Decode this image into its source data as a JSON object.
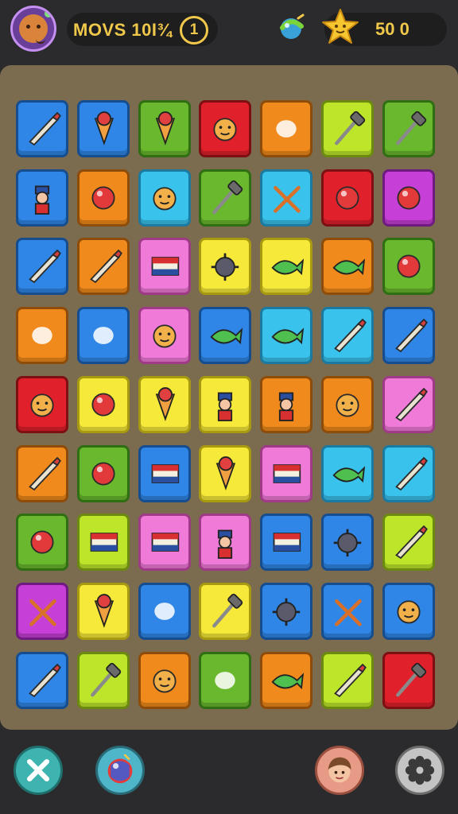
{
  "header": {
    "moves_label": "MOVS 10I¾",
    "moves_count": "1",
    "score": "50 0"
  },
  "colors": {
    "blue": "#2f86e6",
    "sky": "#39c3ec",
    "green": "#6ab82d",
    "red": "#e0202a",
    "orange": "#f08a1c",
    "lime": "#bde62a",
    "pink": "#f07ad8",
    "purple": "#c63fd6",
    "yellow": "#f6e93a",
    "board": "#7b6b4f"
  },
  "board": {
    "rows": 9,
    "cols": 7,
    "tiles": [
      [
        {
          "color": "blue",
          "icon": "crayon-icon"
        },
        {
          "color": "blue",
          "icon": "popsicle-icon"
        },
        {
          "color": "green",
          "icon": "chili-icon"
        },
        {
          "color": "red",
          "icon": "pig-face-icon"
        },
        {
          "color": "orange",
          "icon": "genie-lamp-icon"
        },
        {
          "color": "lime",
          "icon": "wrench-icon"
        },
        {
          "color": "green",
          "icon": "hammer-icon"
        }
      ],
      [
        {
          "color": "blue",
          "icon": "nutcracker-icon"
        },
        {
          "color": "orange",
          "icon": "spiky-ball-icon"
        },
        {
          "color": "sky",
          "icon": "gear-face-icon"
        },
        {
          "color": "green",
          "icon": "mallet-icon"
        },
        {
          "color": "sky",
          "icon": "stick-icon"
        },
        {
          "color": "red",
          "icon": "crystal-ball-icon"
        },
        {
          "color": "purple",
          "icon": "spiky-ball-icon"
        }
      ],
      [
        {
          "color": "blue",
          "icon": "green-crayon-icon"
        },
        {
          "color": "orange",
          "icon": "feather-icon"
        },
        {
          "color": "pink",
          "icon": "map-icon"
        },
        {
          "color": "yellow",
          "icon": "ship-wheel-icon"
        },
        {
          "color": "yellow",
          "icon": "bird-icon"
        },
        {
          "color": "orange",
          "icon": "slime-icon"
        },
        {
          "color": "green",
          "icon": "beach-ball-icon"
        }
      ],
      [
        {
          "color": "orange",
          "icon": "radio-icon"
        },
        {
          "color": "blue",
          "icon": "sun-icon"
        },
        {
          "color": "pink",
          "icon": "lemon-face-icon"
        },
        {
          "color": "blue",
          "icon": "fish-icon"
        },
        {
          "color": "sky",
          "icon": "leaf-icon"
        },
        {
          "color": "sky",
          "icon": "feather-icon"
        },
        {
          "color": "blue",
          "icon": "surfboard-icon"
        }
      ],
      [
        {
          "color": "red",
          "icon": "yellow-creature-icon"
        },
        {
          "color": "yellow",
          "icon": "red-ball-icon"
        },
        {
          "color": "yellow",
          "icon": "lantern-icon",
          "span": 1
        },
        {
          "color": "yellow",
          "icon": "soldier-icon"
        },
        {
          "color": "orange",
          "icon": "soldier-icon"
        },
        {
          "color": "orange",
          "icon": "chick-face-icon"
        },
        {
          "color": "pink",
          "icon": "feather-icon"
        },
        {
          "color": "red",
          "icon": "cat-icon"
        }
      ],
      [
        {
          "color": "orange",
          "icon": "paintbrush-icon"
        },
        {
          "color": "green",
          "icon": "beach-ball-icon"
        },
        {
          "color": "blue",
          "icon": "flag-icon"
        },
        {
          "color": "yellow",
          "icon": "candy-icon"
        },
        {
          "color": "pink",
          "icon": "pennant-icon"
        },
        {
          "color": "sky",
          "icon": "purple-fish-icon"
        },
        {
          "color": "sky",
          "icon": "sword-icon"
        }
      ],
      [
        {
          "color": "green",
          "icon": "apple-icon"
        },
        {
          "color": "lime",
          "icon": "picture-frame-icon"
        },
        {
          "color": "pink",
          "icon": "plank-icon"
        },
        {
          "color": "pink",
          "icon": "soldier-icon"
        },
        {
          "color": "blue",
          "icon": "sign-icon"
        },
        {
          "color": "blue",
          "icon": "bomb-icon"
        },
        {
          "color": "lime",
          "icon": "purple-crayon-icon"
        },
        {
          "color": "purple",
          "icon": "crayon-icon"
        }
      ],
      [
        {
          "color": "purple",
          "icon": "crossed-sticks-icon"
        },
        {
          "color": "yellow",
          "icon": "ice-cream-cone-icon"
        },
        {
          "color": "blue",
          "icon": "microphone-icon"
        },
        {
          "color": "yellow",
          "icon": "hammer-icon"
        },
        {
          "color": "blue",
          "icon": "mine-icon"
        },
        {
          "color": "blue",
          "icon": "crossed-sticks-icon"
        },
        {
          "color": "blue",
          "icon": "green-monster-icon"
        }
      ],
      [
        {
          "color": "blue",
          "icon": "surfboard-icon"
        },
        {
          "color": "lime",
          "icon": "spinning-top-icon"
        },
        {
          "color": "orange",
          "icon": "bear-face-icon"
        },
        {
          "color": "green",
          "icon": "blaster-icon"
        },
        {
          "color": "orange",
          "icon": "green-fish-icon"
        },
        {
          "color": "lime",
          "icon": "sword-icon"
        },
        {
          "color": "red",
          "icon": "pin-icon"
        }
      ]
    ]
  },
  "bottom_bar": {
    "buttons": [
      "close-icon",
      "boost-ball-icon",
      "friend-avatar-icon",
      "settings-gear-icon"
    ]
  }
}
